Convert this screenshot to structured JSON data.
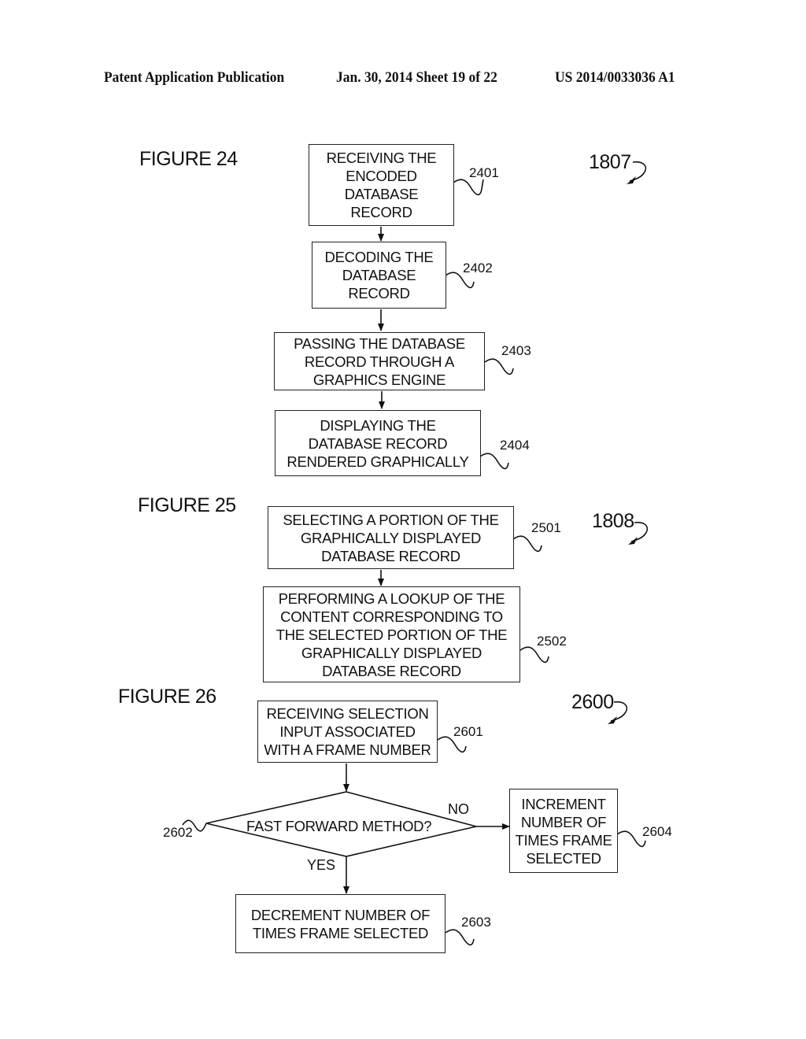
{
  "header": {
    "publication": "Patent Application Publication",
    "date_sheet": "Jan. 30, 2014  Sheet 19 of 22",
    "number": "US 2014/0033036 A1"
  },
  "figure24": {
    "title": "FIGURE 24",
    "ref": "1807",
    "steps": [
      {
        "ref": "2401",
        "text": "RECEIVING THE\nENCODED\nDATABASE\nRECORD"
      },
      {
        "ref": "2402",
        "text": "DECODING THE\nDATABASE\nRECORD"
      },
      {
        "ref": "2403",
        "text": "PASSING THE DATABASE\nRECORD THROUGH A\nGRAPHICS ENGINE"
      },
      {
        "ref": "2404",
        "text": "DISPLAYING THE\nDATABASE RECORD\nRENDERED GRAPHICALLY"
      }
    ]
  },
  "figure25": {
    "title": "FIGURE 25",
    "ref": "1808",
    "steps": [
      {
        "ref": "2501",
        "text": "SELECTING A PORTION OF THE\nGRAPHICALLY DISPLAYED\nDATABASE RECORD"
      },
      {
        "ref": "2502",
        "text": "PERFORMING A LOOKUP OF THE\nCONTENT CORRESPONDING TO\nTHE  SELECTED PORTION OF THE\nGRAPHICALLY DISPLAYED\nDATABASE RECORD"
      }
    ]
  },
  "figure26": {
    "title": "FIGURE 26",
    "ref": "2600",
    "steps": [
      {
        "ref": "2601",
        "text": "RECEIVING SELECTION\nINPUT ASSOCIATED\nWITH A FRAME NUMBER"
      },
      {
        "ref": "2602",
        "text": "FAST FORWARD METHOD?"
      },
      {
        "ref": "2603",
        "text": "DECREMENT NUMBER OF\nTIMES FRAME SELECTED"
      },
      {
        "ref": "2604",
        "text": "INCREMENT\nNUMBER OF\nTIMES FRAME\nSELECTED"
      }
    ],
    "branch_yes": "YES",
    "branch_no": "NO"
  }
}
